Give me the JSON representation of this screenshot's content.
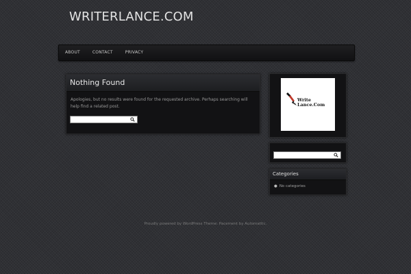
{
  "site": {
    "title": "WRITERLANCE.COM"
  },
  "nav": {
    "items": [
      "ABOUT",
      "CONTACT",
      "PRIVACY"
    ]
  },
  "main": {
    "heading": "Nothing Found",
    "message": "Apologies, but no results were found for the requested archive. Perhaps searching will help find a related post.",
    "search_value": ""
  },
  "sidebar": {
    "logo": {
      "line1": "Write",
      "line2": "Lance.Com"
    },
    "search_value": "",
    "categories": {
      "title": "Categories",
      "empty": "No categories"
    }
  },
  "footer": {
    "powered": "Proudly powered by WordPress",
    "theme": "Theme: Pacement by Automattic."
  },
  "colors": {
    "accent": "#c0392b",
    "background": "#2f3034"
  },
  "icons": {
    "search": "magnifier-icon",
    "pen": "pen-nib-icon"
  }
}
